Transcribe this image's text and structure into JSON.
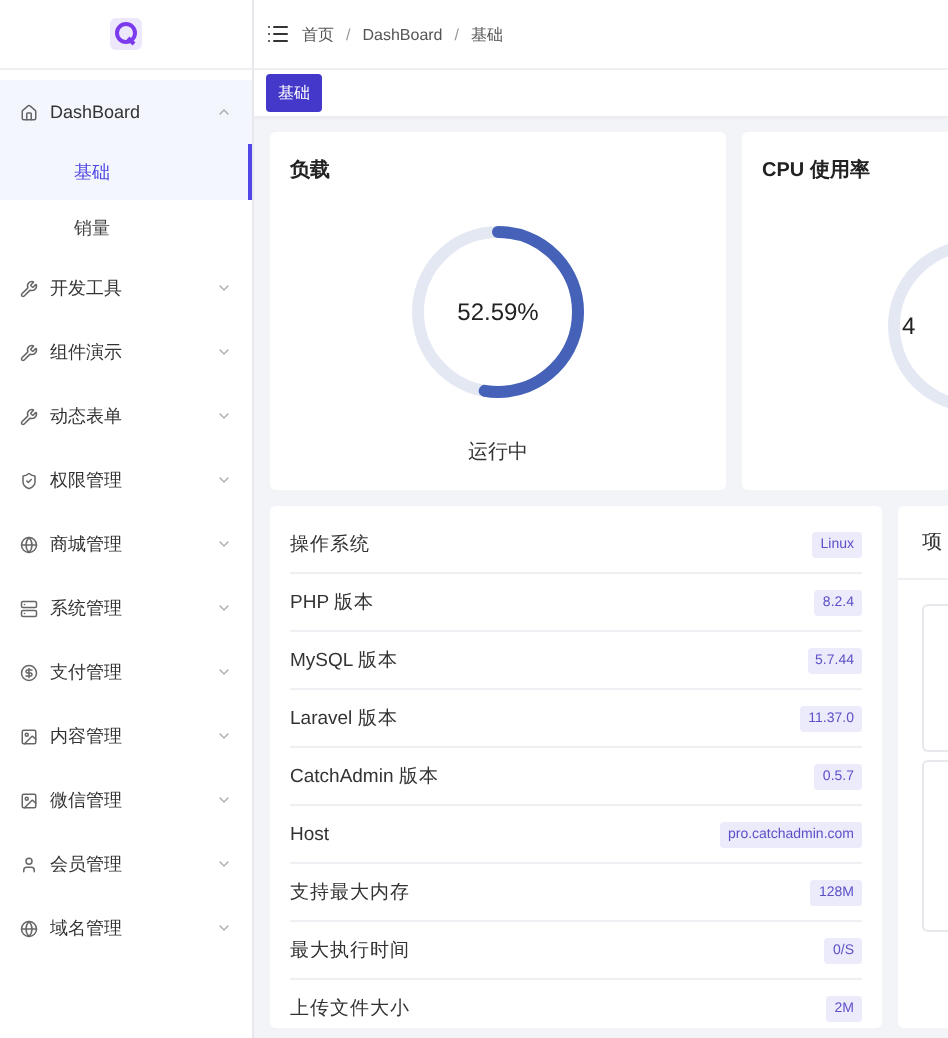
{
  "sidebar": {
    "items": [
      {
        "label": "DashBoard",
        "expanded": true,
        "children": [
          {
            "label": "基础",
            "selected": true
          },
          {
            "label": "销量",
            "selected": false
          }
        ]
      },
      {
        "label": "开发工具",
        "expanded": false
      },
      {
        "label": "组件演示",
        "expanded": false
      },
      {
        "label": "动态表单",
        "expanded": false
      },
      {
        "label": "权限管理",
        "expanded": false
      },
      {
        "label": "商城管理",
        "expanded": false
      },
      {
        "label": "系统管理",
        "expanded": false
      },
      {
        "label": "支付管理",
        "expanded": false
      },
      {
        "label": "内容管理",
        "expanded": false
      },
      {
        "label": "微信管理",
        "expanded": false
      },
      {
        "label": "会员管理",
        "expanded": false
      },
      {
        "label": "域名管理",
        "expanded": false
      }
    ]
  },
  "breadcrumb": {
    "items": [
      "首页",
      "DashBoard",
      "基础"
    ],
    "separator": "/"
  },
  "tags": [
    {
      "label": "基础",
      "selected": true
    }
  ],
  "gauges": [
    {
      "title": "负载",
      "value": "52.59%",
      "level": 0.5259,
      "status": "运行中"
    },
    {
      "title": "CPU 使用率",
      "value": "4"
    }
  ],
  "info": [
    {
      "label": "操作系统",
      "value": "Linux"
    },
    {
      "label": "PHP 版本",
      "value": "8.2.4"
    },
    {
      "label": "MySQL 版本",
      "value": "5.7.44"
    },
    {
      "label": "Laravel 版本",
      "value": "11.37.0"
    },
    {
      "label": "CatchAdmin 版本",
      "value": "0.5.7"
    },
    {
      "label": "Host",
      "value": "pro.catchadmin.com"
    },
    {
      "label": "支持最大内存",
      "value": "128M"
    },
    {
      "label": "最大执行时间",
      "value": "0/S"
    },
    {
      "label": "上传文件大小",
      "value": "2M"
    }
  ],
  "side_card": {
    "title": "项"
  }
}
